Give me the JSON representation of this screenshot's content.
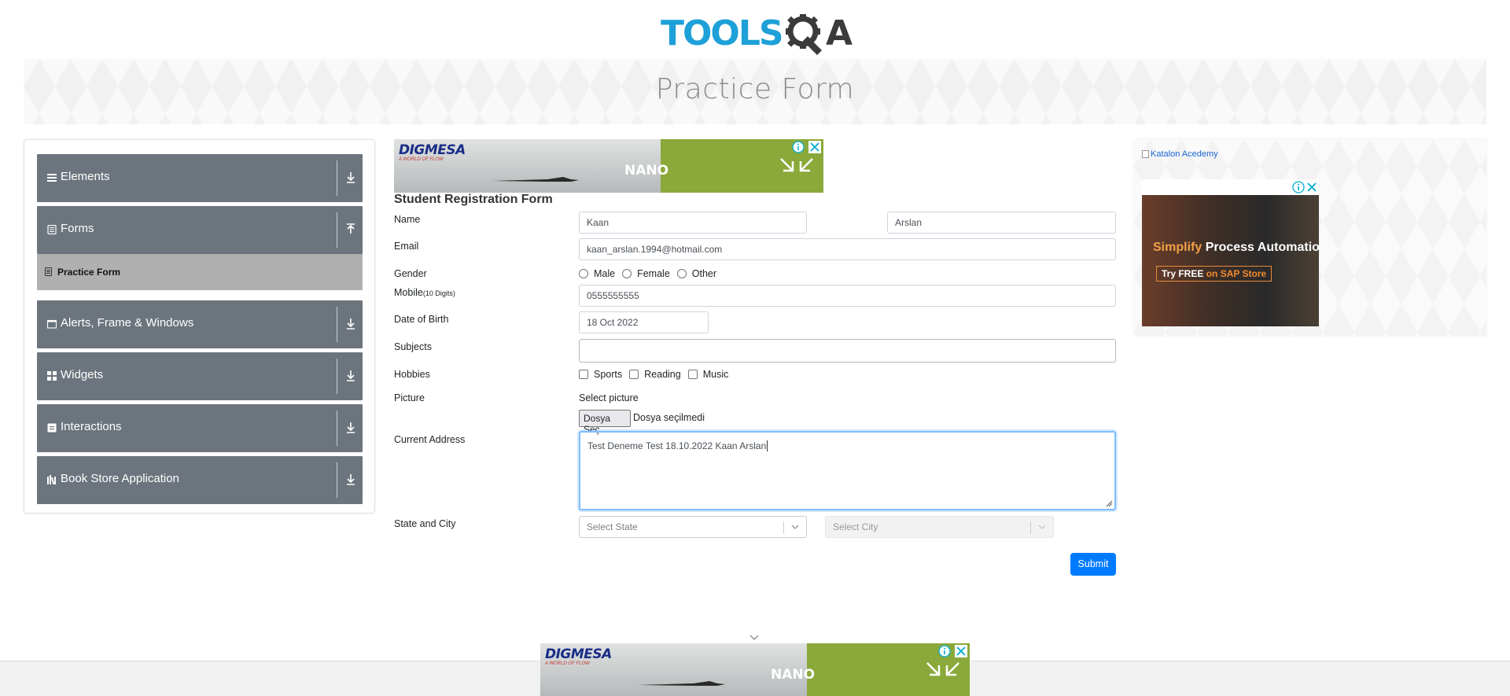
{
  "header": {
    "logo_text": "TOOLSQA",
    "page_title": "Practice Form"
  },
  "sidebar": {
    "groups": [
      {
        "label": "Elements",
        "icon": "list-icon",
        "state": "collapsed"
      },
      {
        "label": "Forms",
        "icon": "document-icon",
        "state": "expanded"
      },
      {
        "label": "Alerts, Frame & Windows",
        "icon": "window-icon",
        "state": "collapsed"
      },
      {
        "label": "Widgets",
        "icon": "grid-icon",
        "state": "collapsed"
      },
      {
        "label": "Interactions",
        "icon": "interaction-icon",
        "state": "collapsed"
      },
      {
        "label": "Book Store Application",
        "icon": "books-icon",
        "state": "collapsed"
      }
    ],
    "active_item": {
      "label": "Practice Form",
      "icon": "document-icon"
    }
  },
  "top_ad": {
    "brand": "DIGMESA",
    "tagline": "A WORLD OF FLOW",
    "product": "NANO"
  },
  "form": {
    "title": "Student Registration Form",
    "name_label": "Name",
    "first_name": "Kaan",
    "last_name": "Arslan",
    "email_label": "Email",
    "email": "kaan_arslan.1994@hotmail.com",
    "gender_label": "Gender",
    "gender_options": [
      "Male",
      "Female",
      "Other"
    ],
    "mobile_label": "Mobile",
    "mobile_hint": "(10 Digits)",
    "mobile": "0555555555",
    "dob_label": "Date of Birth",
    "dob": "18 Oct 2022",
    "subjects_label": "Subjects",
    "subjects": "",
    "hobbies_label": "Hobbies",
    "hobby_options": [
      "Sports",
      "Reading",
      "Music"
    ],
    "picture_label": "Picture",
    "select_picture": "Select picture",
    "file_button": "Dosya Seç",
    "file_status": "Dosya seçilmedi",
    "address_label": "Current Address",
    "address": "Test Deneme Test 18.10.2022 Kaan Arslan",
    "state_city_label": "State and City",
    "state_placeholder": "Select State",
    "city_placeholder": "Select City",
    "submit": "Submit"
  },
  "right_ad": {
    "link_text": "Katalon Acedemy",
    "headline_accent": "Simplify",
    "headline_rest": "Process Automation",
    "cta_main": "Try FREE",
    "cta_accent": "on SAP Store"
  },
  "colors": {
    "sidebar_group": "#6c757d",
    "active_item": "#b0b0b0",
    "primary": "#007bff",
    "logo_blue": "#1ea0d8"
  }
}
